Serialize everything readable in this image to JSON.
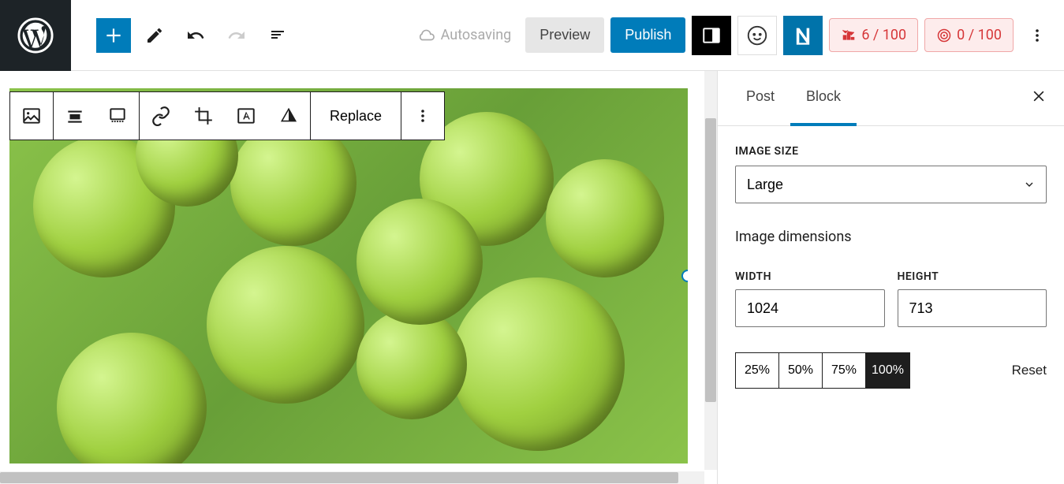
{
  "toolbar": {
    "autosave_label": "Autosaving",
    "preview_label": "Preview",
    "publish_label": "Publish",
    "score1": "6 / 100",
    "score2": "0 / 100"
  },
  "block_toolbar": {
    "replace_label": "Replace"
  },
  "sidebar": {
    "tabs": {
      "post": "Post",
      "block": "Block"
    },
    "image_size_label": "IMAGE SIZE",
    "image_size_value": "Large",
    "image_dimensions_label": "Image dimensions",
    "width_label": "WIDTH",
    "height_label": "HEIGHT",
    "width_value": "1024",
    "height_value": "713",
    "pct25": "25%",
    "pct50": "50%",
    "pct75": "75%",
    "pct100": "100%",
    "reset_label": "Reset"
  }
}
